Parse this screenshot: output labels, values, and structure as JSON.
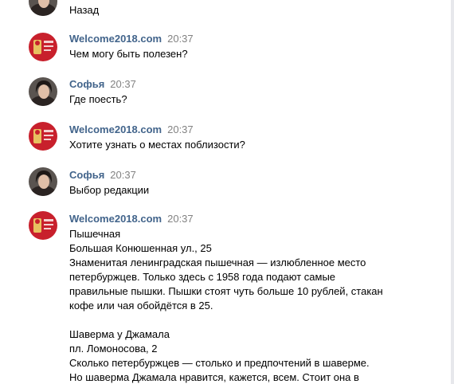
{
  "colors": {
    "author": "#42648b",
    "time": "#828282",
    "text": "#000000",
    "bot_avatar": "#c8202c",
    "background": "#ffffff"
  },
  "messages": [
    {
      "avatar": "user-avatar",
      "text": "Назад"
    },
    {
      "avatar": "bot-logo-avatar",
      "author": "Welcome2018.com",
      "time": "20:37",
      "text": "Чем могу быть полезен?"
    },
    {
      "avatar": "user-avatar",
      "author": "Софья",
      "time": "20:37",
      "text": "Где поесть?"
    },
    {
      "avatar": "bot-logo-avatar",
      "author": "Welcome2018.com",
      "time": "20:37",
      "text": "Хотите узнать о местах поблизости?"
    },
    {
      "avatar": "user-avatar",
      "author": "Софья",
      "time": "20:37",
      "text": "Выбор редакции"
    },
    {
      "avatar": "bot-logo-avatar",
      "author": "Welcome2018.com",
      "time": "20:37",
      "text": "Пышечная\nБольшая Конюшенная ул., 25\nЗнаменитая ленинградская пышечная — излюбленное место\nпетербуржцев. Только здесь с 1958 года подают самые\nправильные пышки. Пышки стоят чуть больше 10 рублей, стакан\nкофе или чая обойдётся в 25.\n\nШаверма у Джамала\nпл. Ломоносова, 2\nСколько петербуржцев — столько и предпочтений в шаверме.\nНо шаверма Джамала нравится, кажется, всем. Стоит она в"
    }
  ]
}
